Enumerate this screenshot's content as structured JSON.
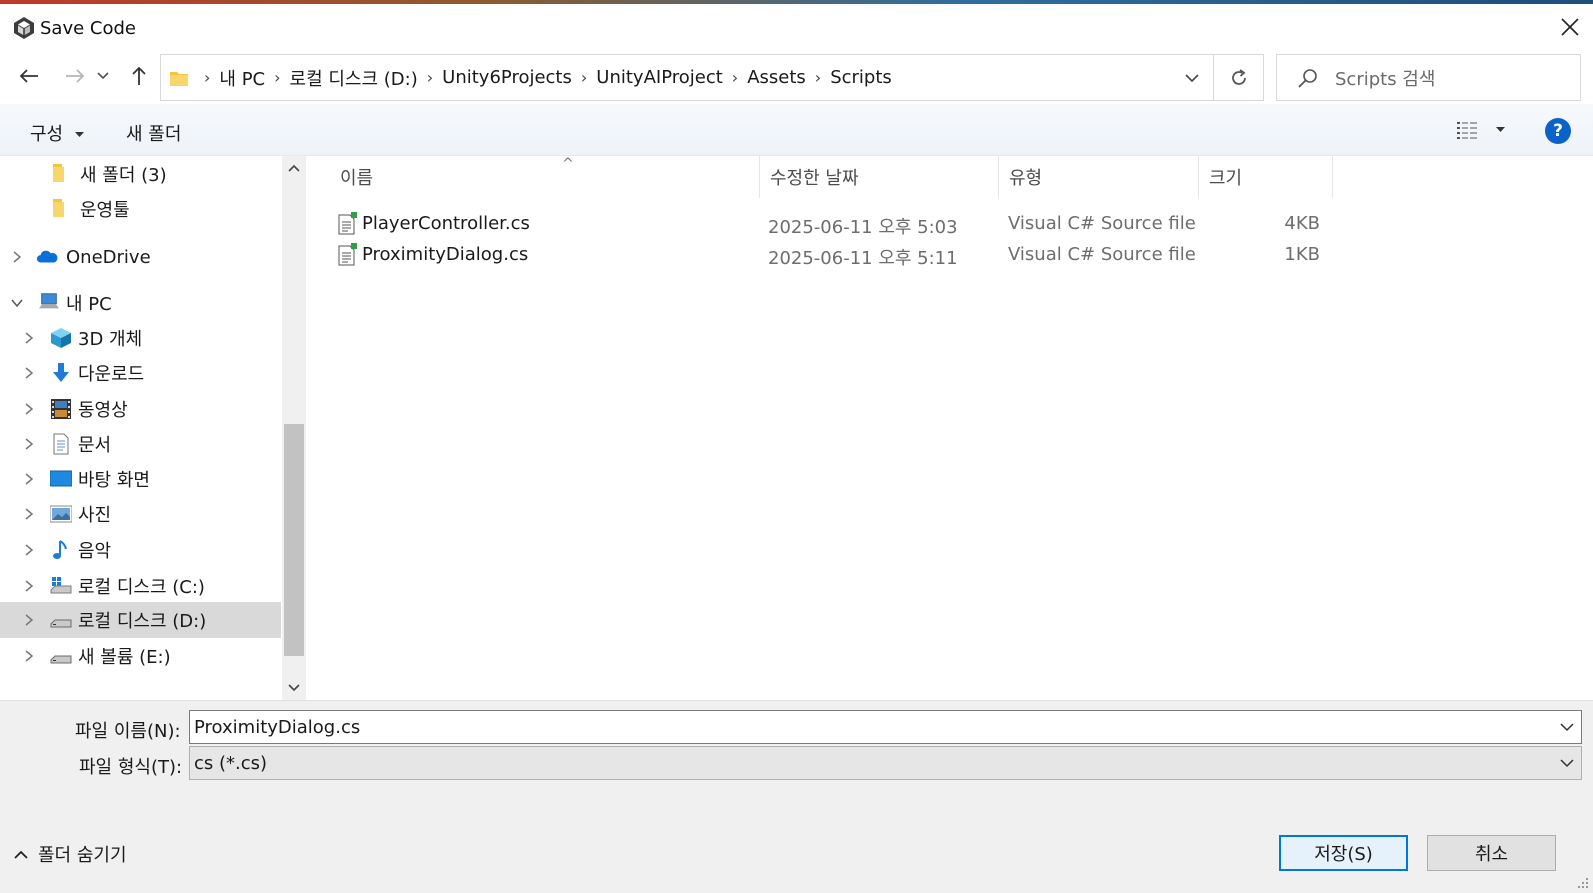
{
  "window": {
    "title": "Save Code",
    "app_icon": "unity-icon",
    "close_icon": "close-icon"
  },
  "nav": {
    "back_icon": "arrow-left-icon",
    "forward_icon": "arrow-right-icon",
    "recent_icon": "chevron-down-icon",
    "up_icon": "arrow-up-icon",
    "breadcrumbs": [
      "내 PC",
      "로컬 디스크 (D:)",
      "Unity6Projects",
      "UnityAIProject",
      "Assets",
      "Scripts"
    ],
    "refresh_icon": "refresh-icon",
    "search_placeholder": "Scripts 검색"
  },
  "commandbar": {
    "organize_label": "구성",
    "new_folder_label": "새 폴더",
    "view_icon": "details-view-icon",
    "help_label": "?"
  },
  "navpane": {
    "items": [
      {
        "label": "새 폴더 (3)",
        "icon": "folder-icon",
        "level": 2,
        "chevron": "none",
        "selected": false
      },
      {
        "label": "운영툴",
        "icon": "folder-icon",
        "level": 2,
        "chevron": "none",
        "selected": false
      },
      {
        "label": "OneDrive",
        "icon": "onedrive-icon",
        "level": 0,
        "chevron": "right",
        "selected": false
      },
      {
        "label": "내 PC",
        "icon": "pc-icon",
        "level": 0,
        "chevron": "down",
        "selected": false
      },
      {
        "label": "3D 개체",
        "icon": "3d-objects-icon",
        "level": 1,
        "chevron": "right",
        "selected": false
      },
      {
        "label": "다운로드",
        "icon": "download-icon",
        "level": 1,
        "chevron": "right",
        "selected": false
      },
      {
        "label": "동영상",
        "icon": "video-icon",
        "level": 1,
        "chevron": "right",
        "selected": false
      },
      {
        "label": "문서",
        "icon": "document-icon",
        "level": 1,
        "chevron": "right",
        "selected": false
      },
      {
        "label": "바탕 화면",
        "icon": "desktop-icon",
        "level": 1,
        "chevron": "right",
        "selected": false
      },
      {
        "label": "사진",
        "icon": "pictures-icon",
        "level": 1,
        "chevron": "right",
        "selected": false
      },
      {
        "label": "음악",
        "icon": "music-icon",
        "level": 1,
        "chevron": "right",
        "selected": false
      },
      {
        "label": "로컬 디스크 (C:)",
        "icon": "windows-drive-icon",
        "level": 1,
        "chevron": "right",
        "selected": false
      },
      {
        "label": "로컬 디스크 (D:)",
        "icon": "drive-icon",
        "level": 1,
        "chevron": "right",
        "selected": true
      },
      {
        "label": "새 볼륨 (E:)",
        "icon": "drive-icon",
        "level": 1,
        "chevron": "right",
        "selected": false
      }
    ]
  },
  "filelist": {
    "columns": [
      "이름",
      "수정한 날짜",
      "유형",
      "크기"
    ],
    "sort_indicator": "^",
    "files": [
      {
        "name": "PlayerController.cs",
        "modified": "2025-06-11 오후 5:03",
        "type": "Visual C# Source file",
        "size": "4KB",
        "icon": "csharp-file-icon"
      },
      {
        "name": "ProximityDialog.cs",
        "modified": "2025-06-11 오후 5:11",
        "type": "Visual C# Source file",
        "size": "1KB",
        "icon": "csharp-file-icon"
      }
    ]
  },
  "form": {
    "filename_label": "파일 이름(N):",
    "filename_value": "ProximityDialog.cs",
    "filetype_label": "파일 형식(T):",
    "filetype_value": "cs (*.cs)",
    "hide_folders_label": "폴더 숨기기",
    "save_label": "저장(S)",
    "cancel_label": "취소"
  },
  "colors": {
    "accent": "#0078d7",
    "selected_row": "#d9d9d9",
    "help": "#0a63c9"
  }
}
